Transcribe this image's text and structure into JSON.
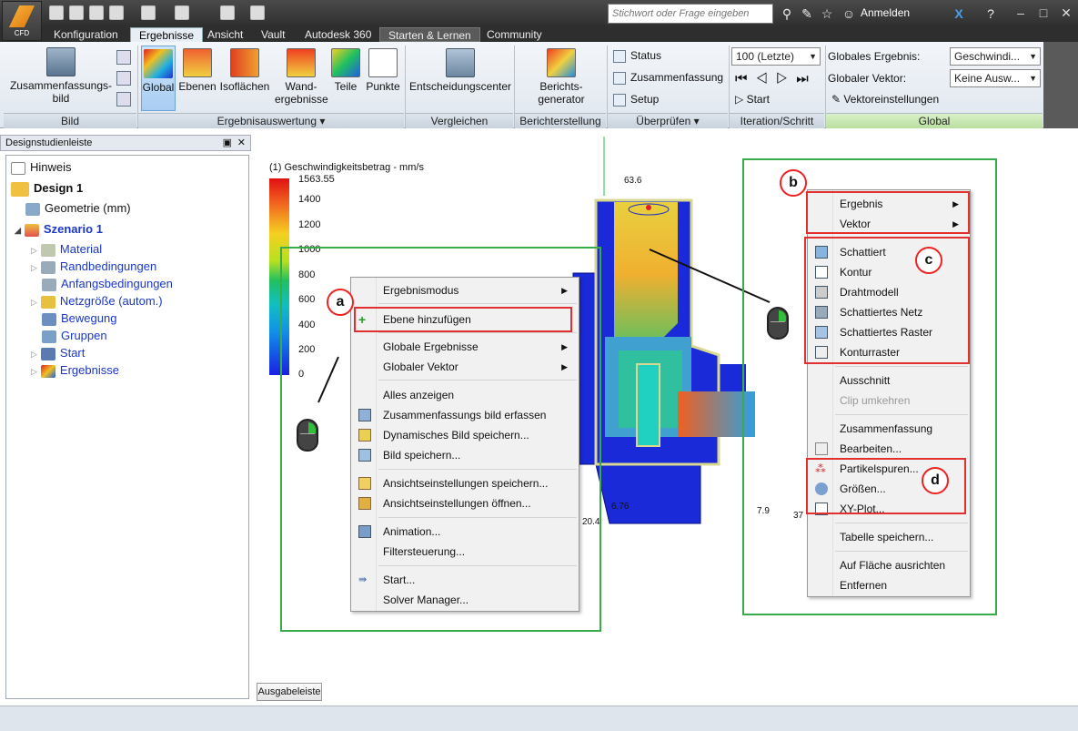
{
  "app": {
    "logo_label": "CFD"
  },
  "search": {
    "placeholder": "Stichwort oder Frage eingeben"
  },
  "login": "Anmelden",
  "tabs": [
    "Konfiguration",
    "Ergebnisse",
    "Ansicht",
    "Vault",
    "Autodesk 360",
    "Starten & Lernen",
    "Community"
  ],
  "ribbon": {
    "bild": {
      "summary_label": "Zusammenfassungs-\nbild",
      "group": "Bild"
    },
    "ergebnis": {
      "buttons": [
        "Global",
        "Ebenen",
        "Isoflächen",
        "Wand-\nergebnisse",
        "Teile",
        "Punkte"
      ],
      "group": "Ergebnisauswertung"
    },
    "vergleichen": {
      "button": "Entscheidungscenter",
      "group": "Vergleichen"
    },
    "bericht": {
      "button": "Berichts-\ngenerator",
      "group": "Berichterstellung"
    },
    "ueberpruefen": {
      "items": [
        "Status",
        "Zusammenfassung",
        "Setup"
      ],
      "group": "Überprüfen"
    },
    "iteration": {
      "select": "100 (Letzte)",
      "start": "Start",
      "group": "Iteration/Schritt"
    },
    "global": {
      "result_label": "Globales Ergebnis:",
      "result_value": "Geschwindi...",
      "vector_label": "Globaler Vektor:",
      "vector_value": "Keine Ausw...",
      "settings": "Vektoreinstellungen",
      "group": "Global"
    }
  },
  "panel": {
    "title": "Designstudienleiste",
    "tree": [
      "Hinweis",
      "Design 1",
      "Geometrie (mm)",
      "Szenario 1",
      "Material",
      "Randbedingungen",
      "Anfangsbedingungen",
      "Netzgröße (autom.)",
      "Bewegung",
      "Gruppen",
      "Start",
      "Ergebnisse"
    ]
  },
  "output_button": "Ausgabeleiste",
  "legend": {
    "title": "(1) Geschwindigkeitsbetrag - mm/s",
    "max": "1563.55",
    "ticks": [
      "1400",
      "1200",
      "1000",
      "800",
      "600",
      "400",
      "200",
      "0"
    ]
  },
  "annotations": {
    "a": "a",
    "b": "b",
    "c": "c",
    "d": "d",
    "val_top": "63.6",
    "val_left": "20.4",
    "val_mid": "6.76",
    "val_r1": "7.9",
    "val_r2": "37"
  },
  "menu_a": {
    "items": [
      "Ergebnismodus",
      "Ebene hinzufügen",
      "Globale Ergebnisse",
      "Globaler Vektor",
      "Alles anzeigen",
      "Zusammenfassungs bild erfassen",
      "Dynamisches Bild speichern...",
      "Bild speichern...",
      "Ansichtseinstellungen speichern...",
      "Ansichtseinstellungen öffnen...",
      "Animation...",
      "Filtersteuerung...",
      "Start...",
      "Solver Manager..."
    ]
  },
  "menu_b": {
    "items": [
      "Ergebnis",
      "Vektor",
      "Schattiert",
      "Kontur",
      "Drahtmodell",
      "Schattiertes Netz",
      "Schattiertes Raster",
      "Konturraster",
      "Ausschnitt",
      "Clip umkehren",
      "Zusammenfassung",
      "Bearbeiten...",
      "Partikelspuren...",
      "Größen...",
      "XY-Plot...",
      "Tabelle speichern...",
      "Auf Fläche ausrichten",
      "Entfernen"
    ]
  }
}
